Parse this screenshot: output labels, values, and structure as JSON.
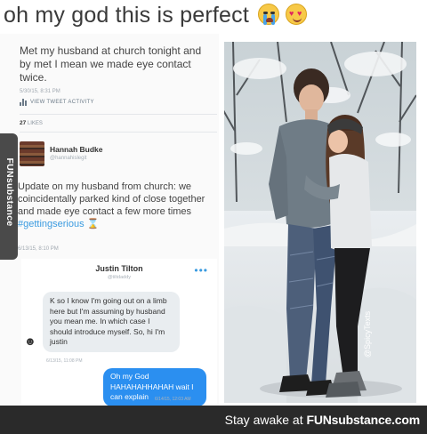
{
  "header": {
    "title": "oh my god this is perfect",
    "emojis": [
      "crying-face",
      "heart-eyes-face"
    ]
  },
  "tweet_1": {
    "text": "Met my husband at church tonight and by met I mean we made eye contact twice.",
    "time": "5/30/15, 8:31 PM",
    "activity_label": "VIEW TWEET ACTIVITY",
    "likes_count": "27",
    "likes_label": "LIKES"
  },
  "tweet_2": {
    "author_name": "Hannah Budke",
    "author_handle": "@hannahislegit",
    "text": "Update on my husband from church: we coincidentally parked kind of close together and made eye contact a few more times",
    "hashtag": "#gettingserious",
    "emoji": "hourglass",
    "time": "6/13/15, 8:10 PM"
  },
  "imessage": {
    "contact_name": "Justin Tilton",
    "contact_handle": "@tiltdaddy",
    "received_text": "K so I know I'm going out on a limb here but I'm assuming by husband you mean me. In which case I should introduce myself. So, hi I'm justin",
    "received_time": "6/13/15, 11:08 PM",
    "sent_text": "Oh my God HAHAHAHHAHAH wait I can explain",
    "sent_time": "6/14/15, 12:03 AM"
  },
  "side_strip": {
    "label": "FUNsubstance"
  },
  "photo": {
    "watermark": "@SpicyTexts"
  },
  "footer": {
    "prefix": "Stay awake at ",
    "brand": "FUNsubstance.com"
  },
  "colors": {
    "link": "#3a9be0",
    "imessage_blue": "#2b8ff0",
    "footer_bg": "#2a2a2a"
  }
}
